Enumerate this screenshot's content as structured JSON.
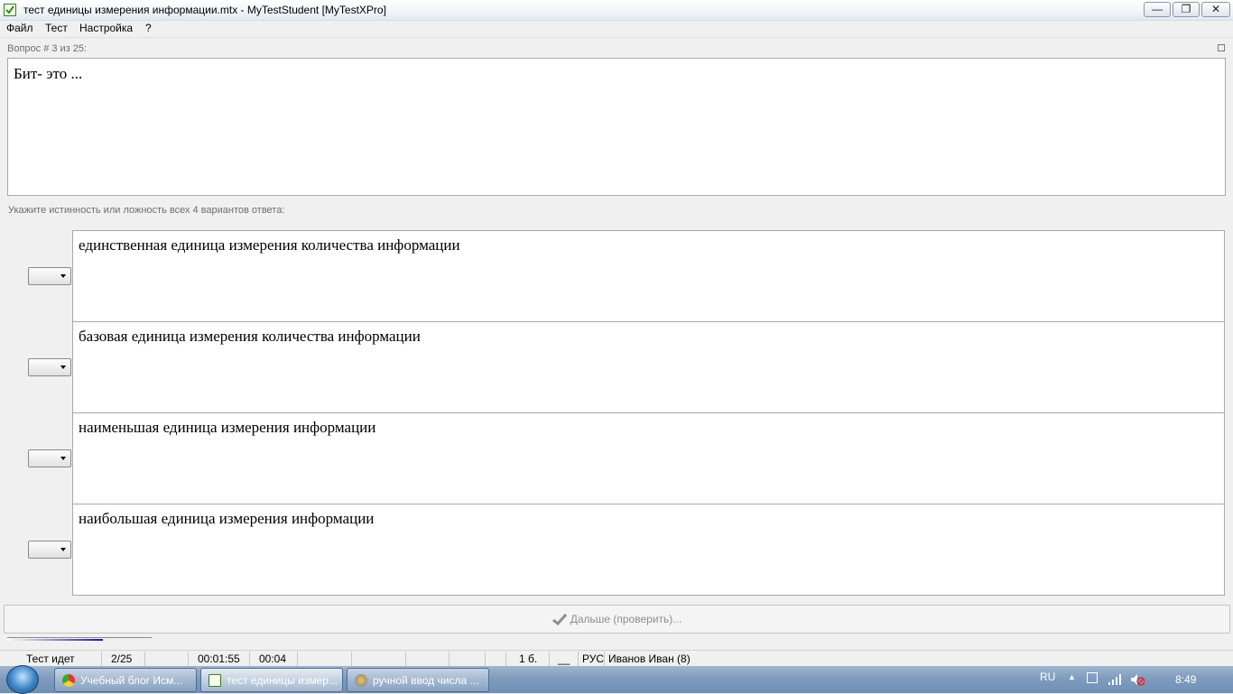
{
  "window": {
    "title": "тест единицы измерения информации.mtx - MyTestStudent [MyTestXPro]",
    "controls": {
      "minimize": "▭",
      "maximize": "❐",
      "close": "✕"
    }
  },
  "menu": [
    "Файл",
    "Тест",
    "Настройка",
    "?"
  ],
  "question": {
    "counter": "Вопрос # 3 из 25:",
    "text": "Бит- это ..."
  },
  "instruction": "Укажите истинность или ложность всех 4 вариантов ответа:",
  "answers": [
    {
      "text": "единственная единица измерения количества информации",
      "value": ""
    },
    {
      "text": "базовая единица измерения количества информации",
      "value": ""
    },
    {
      "text": "наименьшая единица измерения информации",
      "value": ""
    },
    {
      "text": "наибольшая единица измерения информации",
      "value": ""
    }
  ],
  "next_button": {
    "label": "Дальше (проверить)...",
    "icon": "check-icon"
  },
  "progress": {
    "fraction": 0.66
  },
  "status": {
    "state": "Тест идет",
    "position": "2/25",
    "elapsed": "00:01:55",
    "question_time": "00:04",
    "score": "1 б.",
    "blank": "__",
    "lang": "РУС",
    "user": "Иванов Иван (8)"
  },
  "taskbar": {
    "items": [
      {
        "label": "Учебный блог Исм...",
        "icon": "chrome-icon"
      },
      {
        "label": "тест единицы измер...",
        "icon": "mytest-icon",
        "active": true
      },
      {
        "label": "ручной ввод числа ...",
        "icon": "app-icon"
      }
    ],
    "lang": "RU",
    "clock": "8:49"
  }
}
